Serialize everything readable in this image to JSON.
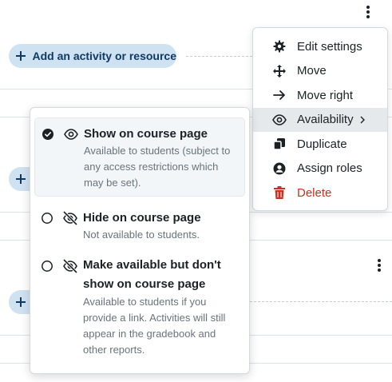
{
  "top_kebab": {
    "icon": "kebab-vertical-icon"
  },
  "add_activity_label": "Add an activity or resource",
  "action_menu": {
    "items": [
      {
        "label": "Edit settings",
        "icon": "gear-icon"
      },
      {
        "label": "Move",
        "icon": "move-arrows-icon"
      },
      {
        "label": "Move right",
        "icon": "arrow-right-icon"
      },
      {
        "label": "Availability",
        "icon": "eye-icon",
        "has_submenu": true,
        "active": true
      },
      {
        "label": "Duplicate",
        "icon": "duplicate-icon"
      },
      {
        "label": "Assign roles",
        "icon": "user-circle-icon"
      },
      {
        "label": "Delete",
        "icon": "trash-icon",
        "danger": true
      }
    ]
  },
  "availability_options": [
    {
      "title": "Show on course page",
      "description": "Available to students (subject to any access restrictions which may be set).",
      "selected": true,
      "icon": "eye-icon"
    },
    {
      "title": "Hide on course page",
      "description": "Not available to students.",
      "selected": false,
      "icon": "eye-slash-icon"
    },
    {
      "title": "Make available but don't show on course page",
      "description": "Available to students if you provide a link. Activities will still appear in the gradebook and other reports.",
      "selected": false,
      "icon": "eye-slash-icon"
    }
  ],
  "colors": {
    "accent": "#0f6cbf",
    "pill_bg": "#cfe2f2",
    "danger": "#ca3120",
    "active_item_bg": "#e6e9ec"
  }
}
